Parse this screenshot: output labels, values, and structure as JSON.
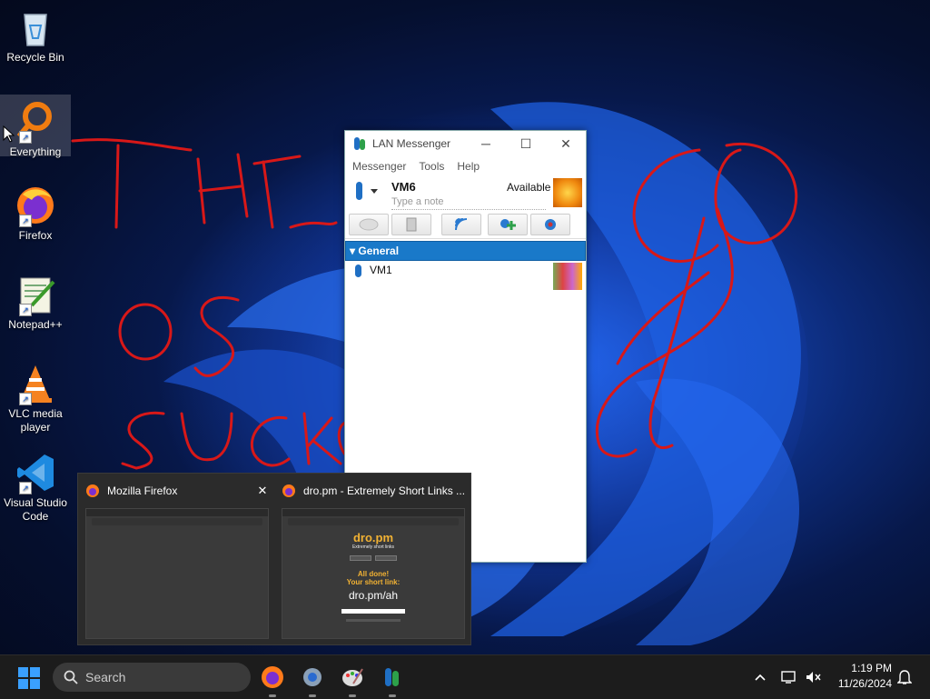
{
  "desktop": {
    "icons": [
      {
        "name": "recycle-bin",
        "label": "Recycle Bin"
      },
      {
        "name": "everything",
        "label": "Everything"
      },
      {
        "name": "firefox",
        "label": "Firefox"
      },
      {
        "name": "notepad-plus-plus",
        "label": "Notepad++"
      },
      {
        "name": "vlc",
        "label": "VLC media player"
      },
      {
        "name": "vscode",
        "label": "Visual Studio Code"
      }
    ],
    "scribble_text": "THE OS SUCKS"
  },
  "lan_messenger": {
    "title": "LAN Messenger",
    "menu": [
      "Messenger",
      "Tools",
      "Help"
    ],
    "user_name": "VM6",
    "user_status": "Available",
    "note_placeholder": "Type a note",
    "group_name": "General",
    "contacts": [
      {
        "name": "VM1"
      }
    ]
  },
  "thumbnails": [
    {
      "title": "Mozilla Firefox",
      "close": "✕"
    },
    {
      "title": "dro.pm - Extremely Short Links ...",
      "page": {
        "logo": "dro.pm",
        "tagline": "Extremely short links",
        "done": "All done!",
        "your_link": "Your short link:",
        "link": "dro.pm/ah"
      }
    }
  ],
  "taskbar": {
    "search_placeholder": "Search",
    "time": "1:19 PM",
    "date": "11/26/2024"
  },
  "colors": {
    "accent_blue": "#1979c9",
    "taskbar": "#1c1c1c",
    "scribble": "#d81818",
    "dropm_yellow": "#f2b233"
  }
}
